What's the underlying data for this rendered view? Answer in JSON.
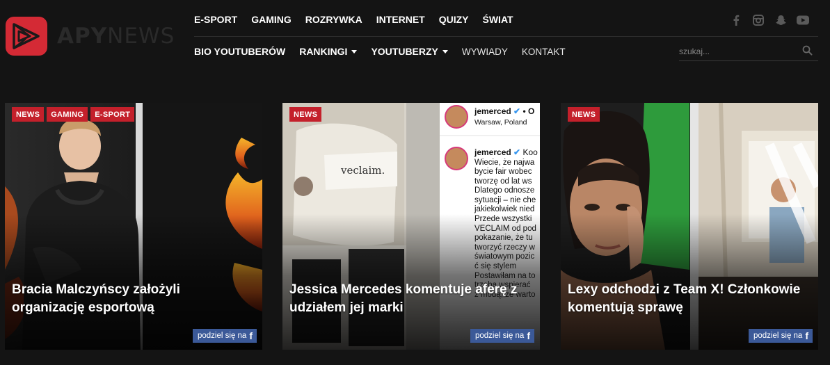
{
  "brand": {
    "logo_text_strong": "APY",
    "logo_text_light": "NEWS",
    "accent": "#d42a35"
  },
  "nav": {
    "top": [
      "E-SPORT",
      "GAMING",
      "ROZRYWKA",
      "INTERNET",
      "QUIZY",
      "ŚWIAT"
    ],
    "bottom": [
      {
        "label": "BIO YOUTUBERÓW",
        "dropdown": false,
        "bold": true
      },
      {
        "label": "RANKINGI",
        "dropdown": true,
        "bold": true
      },
      {
        "label": "YOUTUBERZY",
        "dropdown": true,
        "bold": true
      },
      {
        "label": "WYWIADY",
        "dropdown": false,
        "bold": false
      },
      {
        "label": "KONTAKT",
        "dropdown": false,
        "bold": false
      }
    ]
  },
  "social": [
    "facebook-icon",
    "instagram-icon",
    "snapchat-icon",
    "youtube-icon"
  ],
  "search": {
    "placeholder": "szukaj..."
  },
  "cards": [
    {
      "tags": [
        "NEWS",
        "GAMING",
        "E-SPORT"
      ],
      "title": "Bracia Malczyńscy założyli organizację esportową",
      "share_label": "podziel się na",
      "share_icon": "f"
    },
    {
      "tags": [
        "NEWS"
      ],
      "title": "Jessica Mercedes komentuje aferę z udziałem jej marki",
      "share_label": "podziel się na",
      "share_icon": "f"
    },
    {
      "tags": [
        "NEWS"
      ],
      "title": "Lexy odchodzi z Team X! Członkowie komentują sprawę",
      "share_label": "podziel się na",
      "share_icon": "f"
    }
  ],
  "card2_image": {
    "label_text": "veclaim.",
    "ig_user": "jemerced",
    "ig_location": "Warsaw, Poland",
    "ig_lines": [
      "Wiecie, że najwa",
      "bycie fair wobec",
      "tworzę od lat ws",
      "Dlatego odnosze",
      "sytuacji – nie che",
      "jakiekolwiek nied",
      "Przede wszystki",
      "VECLAIM od pod",
      "pokazanie, że tu",
      "tworzyć rzeczy w",
      "światowym pozic",
      "ć się stylem",
      "Postawiłam na to",
      "trzeba wspierać",
      "z modą, że warto"
    ]
  }
}
